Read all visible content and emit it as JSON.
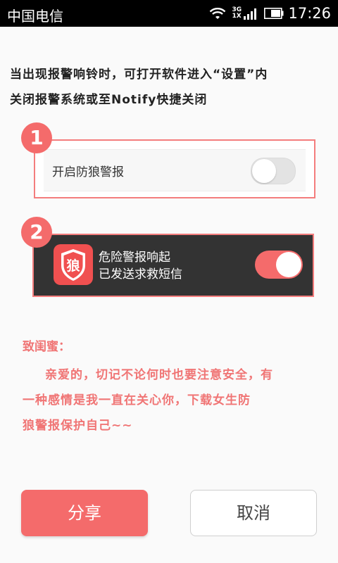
{
  "status_bar": {
    "carrier": "中国电信",
    "network_type_top": "3G",
    "network_type_bottom": "1X",
    "time": "17:26"
  },
  "instruction": {
    "line1": "当出现报警响铃时，可打开软件进入“设置”内",
    "line2": "关闭报警系统或至Notify快捷关闭"
  },
  "step1": {
    "badge": "1",
    "label": "开启防狼警报",
    "toggle_state": "off"
  },
  "step2": {
    "badge": "2",
    "app_icon_char": "狼",
    "notification_line1": "危险警报响起",
    "notification_line2": "已发送求救短信",
    "toggle_state": "on"
  },
  "letter": {
    "salutation": "致闺蜜：",
    "line1": "亲爱的，切记不论何时也要注意安全，有",
    "line2": "一种感情是我一直在关心你，下载女生防",
    "line3": "狼警报保护自己~~"
  },
  "buttons": {
    "share": "分享",
    "cancel": "取消"
  },
  "colors": {
    "accent": "#f46b6b",
    "status_bar": "#000000",
    "notification_bg": "#333333"
  },
  "icons": [
    "wifi-icon",
    "signal-icon",
    "battery-icon",
    "shield-icon"
  ]
}
